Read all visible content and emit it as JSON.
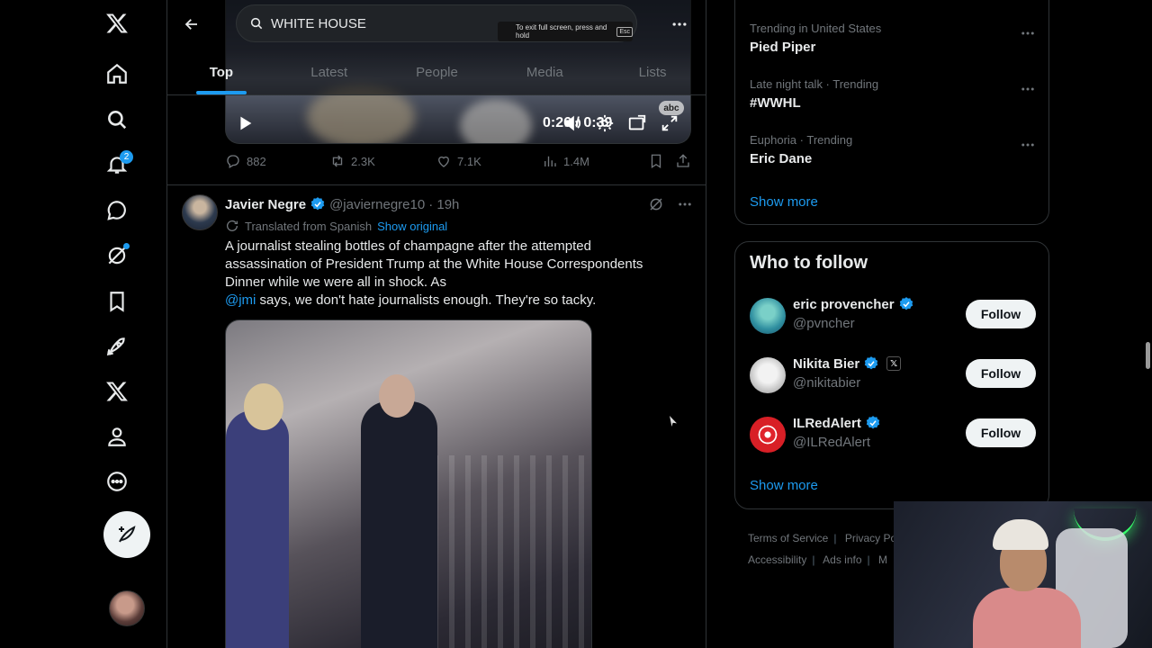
{
  "search": {
    "value": "WHITE HOUSE"
  },
  "fullscreen_hint": {
    "text": "To exit full screen, press and hold",
    "key": "Esc"
  },
  "tabs": [
    {
      "label": "Top",
      "active": true
    },
    {
      "label": "Latest",
      "active": false
    },
    {
      "label": "People",
      "active": false
    },
    {
      "label": "Media",
      "active": false
    },
    {
      "label": "Lists",
      "active": false
    }
  ],
  "nav": {
    "notifications_badge": "2"
  },
  "video": {
    "time": "0:26 / 0:39",
    "watermark": "abc"
  },
  "prev_tweet_actions": {
    "replies": "882",
    "reposts": "2.3K",
    "likes": "7.1K",
    "views": "1.4M"
  },
  "tweet": {
    "name": "Javier Negre",
    "handle": "@javiernegre10",
    "time": "· 19h",
    "translated_label": "Translated from Spanish",
    "show_original": "Show original",
    "text_line1": "A journalist stealing bottles of champagne after the attempted assassination of President Trump at the White House Correspondents Dinner while we were all in shock. As",
    "mention": "@jmi",
    "text_line2": " says, we don't hate journalists enough. They're so tacky."
  },
  "trends": [
    {
      "meta": "Trending in United States",
      "name": "Pied Piper"
    },
    {
      "meta": "Late night talk · Trending",
      "name": "#WWHL"
    },
    {
      "meta": "Euphoria · Trending",
      "name": "Eric Dane"
    }
  ],
  "trends_show_more": "Show more",
  "who_to_follow": {
    "title": "Who to follow",
    "people": [
      {
        "name": "eric provencher",
        "handle": "@pvncher",
        "follow": "Follow"
      },
      {
        "name": "Nikita Bier",
        "handle": "@nikitabier",
        "follow": "Follow",
        "affiliate_badge": "𝕏"
      },
      {
        "name": "ILRedAlert",
        "handle": "@ILRedAlert",
        "follow": "Follow"
      }
    ],
    "show_more": "Show more"
  },
  "footer": {
    "terms": "Terms of Service",
    "privacy": "Privacy Pol",
    "accessibility": "Accessibility",
    "ads": "Ads info",
    "more": "M"
  },
  "colors": {
    "accent": "#1d9bf0",
    "background": "#000000",
    "border": "#2f3336",
    "muted": "#71767b"
  }
}
